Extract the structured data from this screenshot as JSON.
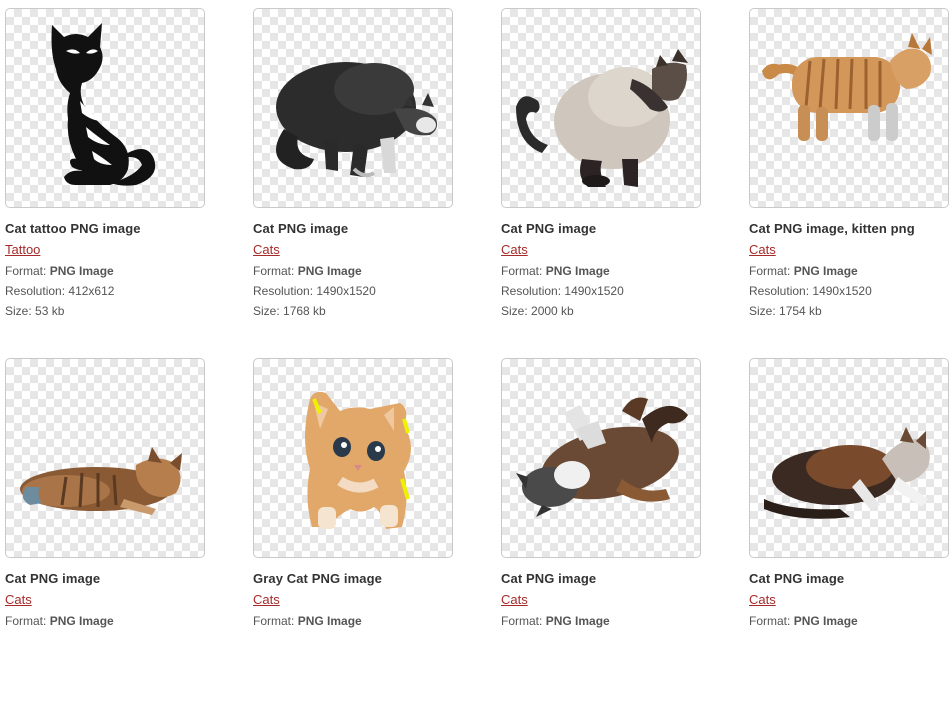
{
  "labels": {
    "format": "Format:",
    "resolution": "Resolution:",
    "size": "Size:"
  },
  "items": [
    {
      "title": "Cat tattoo PNG image",
      "category": "Tattoo",
      "format": "PNG Image",
      "resolution": "412x612",
      "size": "53 kb",
      "art": "tattoo-cat"
    },
    {
      "title": "Cat PNG image",
      "category": "Cats",
      "format": "PNG Image",
      "resolution": "1490x1520",
      "size": "1768 kb",
      "art": "black-cat-crouching"
    },
    {
      "title": "Cat PNG image",
      "category": "Cats",
      "format": "PNG Image",
      "resolution": "1490x1520",
      "size": "2000 kb",
      "art": "siamese-cat-grooming"
    },
    {
      "title": "Cat PNG image, kitten png",
      "category": "Cats",
      "format": "PNG Image",
      "resolution": "1490x1520",
      "size": "1754 kb",
      "art": "orange-tabby-walking"
    },
    {
      "title": "Cat PNG image",
      "category": "Cats",
      "format": "PNG Image",
      "art": "tabby-cat-lying"
    },
    {
      "title": "Gray Cat PNG image",
      "category": "Cats",
      "format": "PNG Image",
      "art": "orange-kitten-front"
    },
    {
      "title": "Cat PNG image",
      "category": "Cats",
      "format": "PNG Image",
      "art": "calico-cat-rolling"
    },
    {
      "title": "Cat PNG image",
      "category": "Cats",
      "format": "PNG Image",
      "art": "calico-cat-crouching"
    }
  ]
}
